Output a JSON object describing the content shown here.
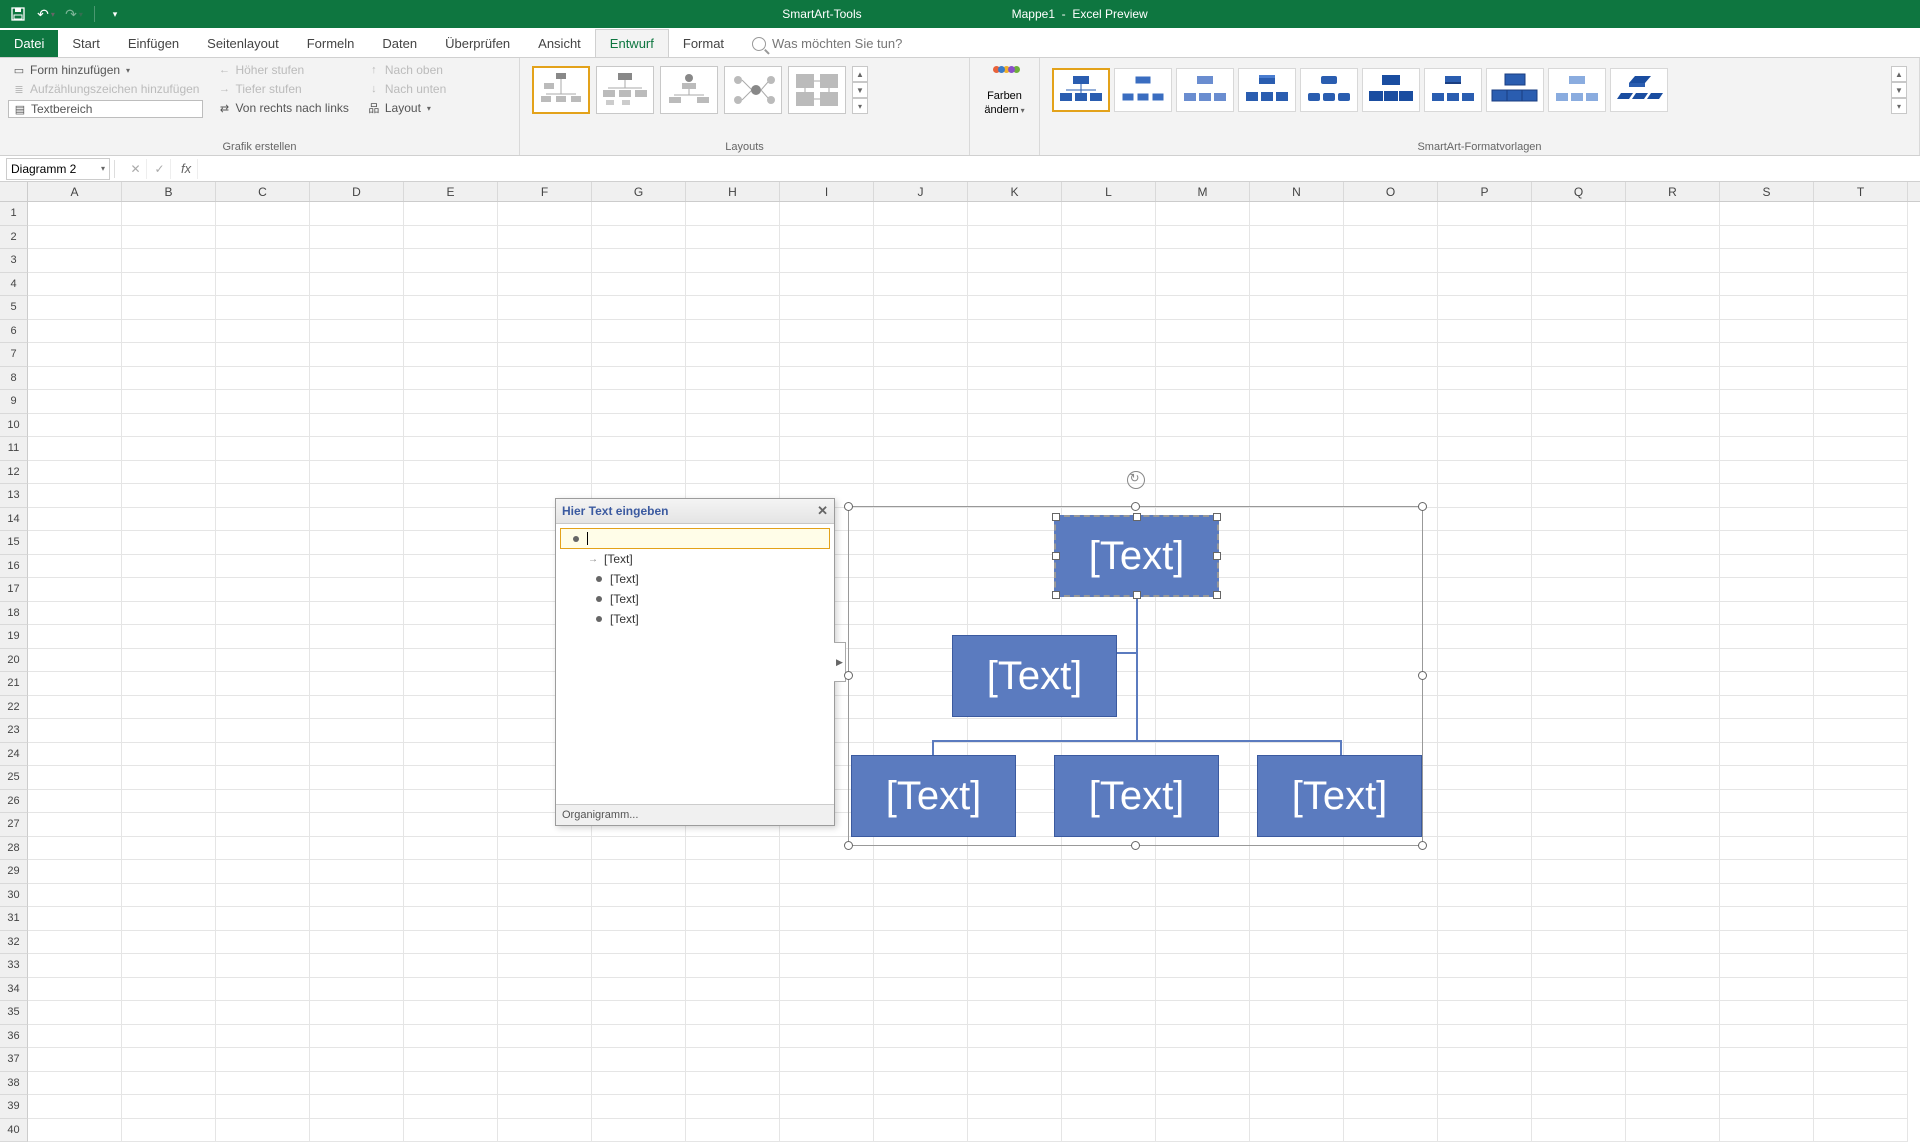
{
  "titlebar": {
    "smartart_tools": "SmartArt-Tools",
    "doc": "Mappe1",
    "app": "Excel Preview"
  },
  "tabs": {
    "datei": "Datei",
    "start": "Start",
    "einfuegen": "Einfügen",
    "seitenlayout": "Seitenlayout",
    "formeln": "Formeln",
    "daten": "Daten",
    "ueberpruefen": "Überprüfen",
    "ansicht": "Ansicht",
    "entwurf": "Entwurf",
    "format": "Format",
    "tellme": "Was möchten Sie tun?"
  },
  "ribbon": {
    "grafik": {
      "form_hinzu": "Form hinzufügen",
      "aufz": "Aufzählungszeichen hinzufügen",
      "textbereich": "Textbereich",
      "hoeher": "Höher stufen",
      "tiefer": "Tiefer stufen",
      "rtl": "Von rechts nach links",
      "oben": "Nach oben",
      "unten": "Nach unten",
      "layout": "Layout",
      "label": "Grafik erstellen"
    },
    "layouts_label": "Layouts",
    "farben": {
      "label1": "Farben",
      "label2": "ändern"
    },
    "styles_label": "SmartArt-Formatvorlagen"
  },
  "formula": {
    "name": "Diagramm 2"
  },
  "columns": [
    "A",
    "B",
    "C",
    "D",
    "E",
    "F",
    "G",
    "H",
    "I",
    "J",
    "K",
    "L",
    "M",
    "N",
    "O",
    "P",
    "Q",
    "R",
    "S",
    "T"
  ],
  "rowcount": 40,
  "textpane": {
    "title": "Hier Text eingeben",
    "items": [
      "[Text]",
      "[Text]",
      "[Text]",
      "[Text]"
    ],
    "footer": "Organigramm..."
  },
  "smartart": {
    "placeholder": "[Text]"
  }
}
